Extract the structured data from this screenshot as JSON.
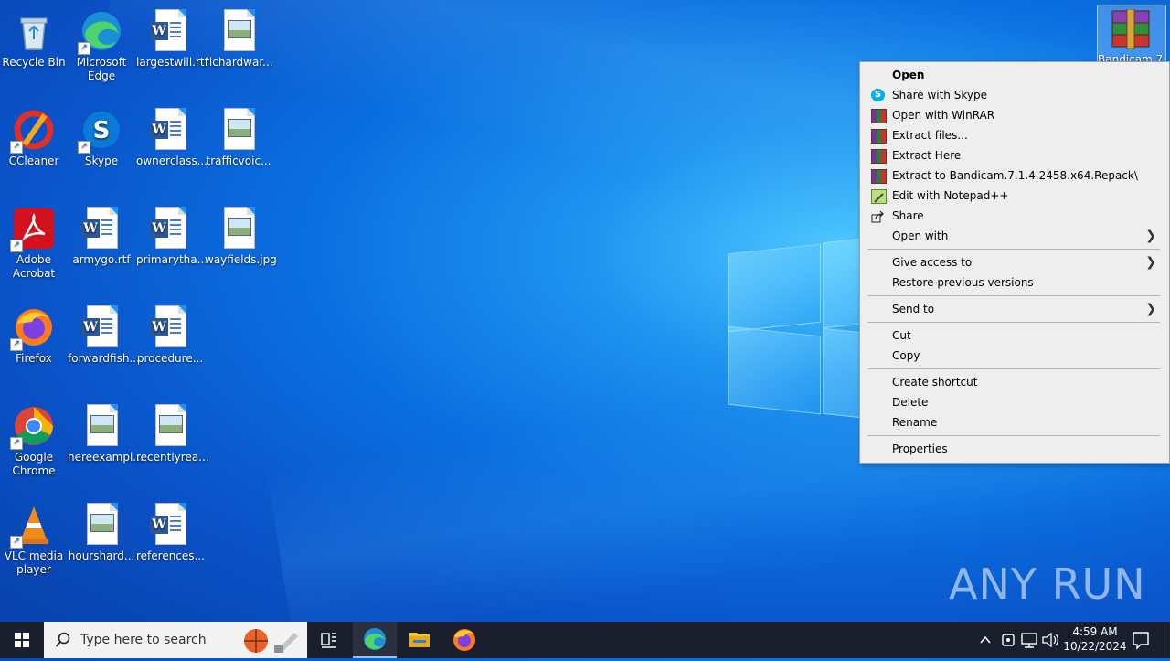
{
  "desktop": {
    "icons": [
      {
        "label": "Recycle Bin"
      },
      {
        "label": "Microsoft Edge"
      },
      {
        "label": "largestwill.rtf"
      },
      {
        "label": "richardwar..."
      },
      {
        "label": "CCleaner"
      },
      {
        "label": "Skype"
      },
      {
        "label": "ownerclass..."
      },
      {
        "label": "trafficvoic..."
      },
      {
        "label": "Adobe Acrobat"
      },
      {
        "label": "armygo.rtf"
      },
      {
        "label": "primarytha..."
      },
      {
        "label": "wayfields.jpg"
      },
      {
        "label": "Firefox"
      },
      {
        "label": "forwardfish..."
      },
      {
        "label": "procedure..."
      },
      {
        "label": "Google Chrome"
      },
      {
        "label": "hereexampl..."
      },
      {
        "label": "recentlyrea..."
      },
      {
        "label": "VLC media player"
      },
      {
        "label": "hourshard..."
      },
      {
        "label": "references..."
      }
    ],
    "selected_icon_label": "Bandicam.7.1"
  },
  "context_menu": {
    "items": [
      {
        "label": "Open",
        "icon": ""
      },
      {
        "label": "Share with Skype",
        "icon": "skype-icon"
      },
      {
        "label": "Open with WinRAR",
        "icon": "winrar-icon"
      },
      {
        "label": "Extract files...",
        "icon": "winrar-icon"
      },
      {
        "label": "Extract Here",
        "icon": "winrar-icon"
      },
      {
        "label": "Extract to Bandicam.7.1.4.2458.x64.Repack\\",
        "icon": "winrar-icon"
      },
      {
        "label": "Edit with Notepad++",
        "icon": "notepadpp-icon"
      },
      {
        "label": "Share",
        "icon": "share-icon"
      },
      {
        "label": "Open with",
        "icon": "",
        "submenu": true
      },
      {
        "label": "Give access to",
        "icon": "",
        "submenu": true
      },
      {
        "label": "Restore previous versions",
        "icon": ""
      },
      {
        "label": "Send to",
        "icon": "",
        "submenu": true
      },
      {
        "label": "Cut",
        "icon": ""
      },
      {
        "label": "Copy",
        "icon": ""
      },
      {
        "label": "Create shortcut",
        "icon": ""
      },
      {
        "label": "Delete",
        "icon": ""
      },
      {
        "label": "Rename",
        "icon": ""
      },
      {
        "label": "Properties",
        "icon": ""
      }
    ]
  },
  "watermark": {
    "text": "ANY RUN"
  },
  "taskbar": {
    "search_placeholder": "Type here to search",
    "clock_time": "4:59 AM",
    "clock_date": "10/22/2024"
  },
  "colors": {
    "desktop_blue": "#0a6fe0",
    "taskbar_bg": "#1a1f2e",
    "menu_bg": "#eeeeee"
  }
}
